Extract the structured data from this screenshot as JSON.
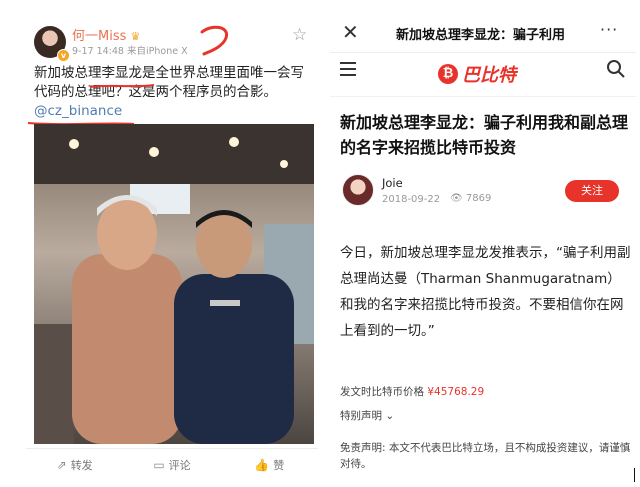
{
  "weibo": {
    "username": "何一Miss",
    "time": "9-17 14:48",
    "source": "来自iPhone X",
    "text_before": "新加坡总理李显龙是全世界总理里面唯一会写代码的总理吧？这是两个程序员的合影。",
    "mention": "@cz_binance",
    "actions": [
      {
        "icon": "share-icon",
        "label": "转发"
      },
      {
        "icon": "comment-icon",
        "label": "评论"
      },
      {
        "icon": "like-icon",
        "label": "赞"
      }
    ]
  },
  "article": {
    "page_title": "新加坡总理李显龙：骗子利用",
    "brand": "巴比特",
    "title": "新加坡总理李显龙：骗子利用我和副总理的名字来招揽比特币投资",
    "author": "Joie",
    "date": "2018-09-22",
    "views": "7869",
    "follow_label": "关注",
    "body": "今日，新加坡总理李显龙发推表示，“骗子利用副总理尚达曼（Tharman Shanmugaratnam）和我的名字来招揽比特币投资。不要相信你在网上看到的一切。”",
    "price_label": "发文时比特币价格",
    "price_value": "¥45768.29",
    "special_label": "特别声明",
    "disclaimer": "免责声明: 本文不代表巴比特立场，且不构成投资建议，请谨慎对待。"
  },
  "colors": {
    "brand_red": "#e8332a",
    "weibo_orange": "#eb7350",
    "mention_blue": "#507daf",
    "annotation_red": "#e8332a"
  }
}
